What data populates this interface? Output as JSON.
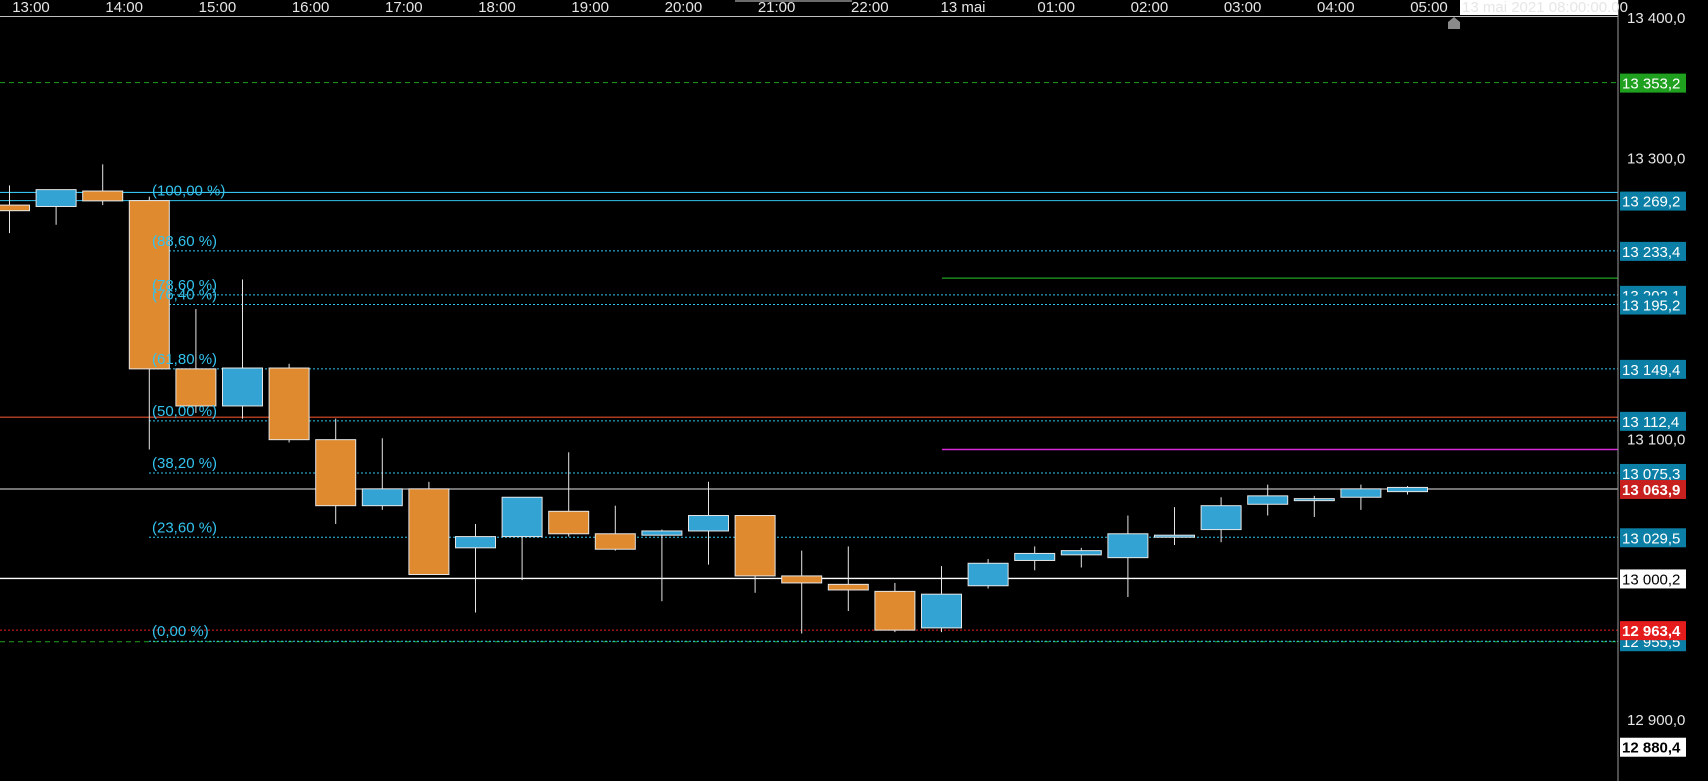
{
  "chart_data": {
    "type": "candlestick",
    "x_tick_labels": [
      "13:00",
      "14:00",
      "15:00",
      "16:00",
      "17:00",
      "18:00",
      "19:00",
      "20:00",
      "21:00",
      "22:00",
      "13 mai",
      "01:00",
      "02:00",
      "03:00",
      "04:00",
      "05:00"
    ],
    "crosshair_time": "13 mai 2021 08:00:00.00",
    "y_tick_labels": [
      "13 400,0",
      "13 300,0",
      "13 100,0",
      "12 900,0"
    ],
    "ylim": [
      12856,
      13412
    ],
    "candles": [
      {
        "o": 13266,
        "h": 13280,
        "l": 13246,
        "c": 13262
      },
      {
        "o": 13265,
        "h": 13275,
        "l": 13252,
        "c": 13277
      },
      {
        "o": 13276,
        "h": 13295,
        "l": 13266,
        "c": 13269
      },
      {
        "o": 13269.2,
        "h": 13272,
        "l": 13092,
        "c": 13149.4
      },
      {
        "o": 13149.4,
        "h": 13192,
        "l": 13118,
        "c": 13123
      },
      {
        "o": 13123,
        "h": 13213,
        "l": 13114,
        "c": 13150
      },
      {
        "o": 13150,
        "h": 13153,
        "l": 13097,
        "c": 13099
      },
      {
        "o": 13099,
        "h": 13114,
        "l": 13039,
        "c": 13052
      },
      {
        "o": 13052,
        "h": 13100,
        "l": 13049,
        "c": 13064
      },
      {
        "o": 13064,
        "h": 13069,
        "l": 13004,
        "c": 13003
      },
      {
        "o": 13022,
        "h": 13039,
        "l": 12976,
        "c": 13030
      },
      {
        "o": 13030,
        "h": 13058,
        "l": 12999,
        "c": 13058
      },
      {
        "o": 13048,
        "h": 13090,
        "l": 13030,
        "c": 13032
      },
      {
        "o": 13032,
        "h": 13052,
        "l": 13020,
        "c": 13021
      },
      {
        "o": 13031,
        "h": 13035,
        "l": 12984,
        "c": 13034
      },
      {
        "o": 13034,
        "h": 13069,
        "l": 13010,
        "c": 13045
      },
      {
        "o": 13045,
        "h": 13041,
        "l": 12990,
        "c": 13002
      },
      {
        "o": 13002,
        "h": 13020,
        "l": 12961,
        "c": 12997
      },
      {
        "o": 12996,
        "h": 13023,
        "l": 12977,
        "c": 12992
      },
      {
        "o": 12991,
        "h": 12997,
        "l": 12962,
        "c": 12963.4
      },
      {
        "o": 12965,
        "h": 13009,
        "l": 12962,
        "c": 12989
      },
      {
        "o": 12995,
        "h": 13014,
        "l": 12993,
        "c": 13011
      },
      {
        "o": 13013,
        "h": 13023,
        "l": 13006,
        "c": 13018
      },
      {
        "o": 13017,
        "h": 13022,
        "l": 13008,
        "c": 13020
      },
      {
        "o": 13015,
        "h": 13045,
        "l": 12987,
        "c": 13032
      },
      {
        "o": 13031,
        "h": 13051,
        "l": 13024,
        "c": 13031
      },
      {
        "o": 13035,
        "h": 13058,
        "l": 13026,
        "c": 13052
      },
      {
        "o": 13053,
        "h": 13067,
        "l": 13045,
        "c": 13059
      },
      {
        "o": 13057,
        "h": 13059,
        "l": 13044,
        "c": 13057
      },
      {
        "o": 13058,
        "h": 13067,
        "l": 13049,
        "c": 13064
      },
      {
        "o": 13062,
        "h": 13066,
        "l": 13060,
        "c": 13065
      }
    ],
    "fib_levels": [
      {
        "label": "(100,00 %)",
        "value": 13269.2,
        "price_label": "13 269,2"
      },
      {
        "label": "(88,60 %)",
        "value": 13233.4,
        "price_label": "13 233,4"
      },
      {
        "label": "(78,60 %)",
        "value": 13202.1,
        "price_label": "13 202,1"
      },
      {
        "label": "(76,40 %)",
        "value": 13195.2,
        "price_label": "13 195,2"
      },
      {
        "label": "(61,80 %)",
        "value": 13149.4,
        "price_label": "13 149,4"
      },
      {
        "label": "(50,00 %)",
        "value": 13112.4,
        "price_label": "13 112,4"
      },
      {
        "label": "(38,20 %)",
        "value": 13075.3,
        "price_label": "13 075,3"
      },
      {
        "label": "(23,60 %)",
        "value": 13029.5,
        "price_label": "13 029,5"
      },
      {
        "label": "(0,00 %)",
        "value": 12955.5,
        "price_label": "12 955,5"
      }
    ],
    "horizontal_lines": {
      "resistance_dashed": {
        "value": 13353.2,
        "label": "13 353,2",
        "color": "#1fa11f"
      },
      "support_dashed": {
        "value": 12955.5,
        "color": "#1fa11f"
      },
      "blue_solid": {
        "value": 13275,
        "color": "#33c3ee"
      },
      "red_solid": {
        "value": 13115,
        "color": "#e0502a"
      },
      "last_price": {
        "value": 13063.9,
        "label": "13 063,9",
        "color": "#c8201e"
      },
      "round_level": {
        "value": 13000.2,
        "label": "13 000,2"
      },
      "low_level": {
        "value": 12963.4,
        "label": "12 963,4",
        "color": "#e51c1c"
      },
      "bottom_label": {
        "value": 12880.4,
        "label": "12 880,4"
      }
    },
    "segments": [
      {
        "value": 13214,
        "color": "#1fa11f"
      },
      {
        "value": 13092,
        "color": "#d62ad6"
      }
    ],
    "colors": {
      "up": "#33a3d4",
      "down": "#e08a30",
      "axis_bg": "#000000",
      "text": "#e6e6e6",
      "fib": "#33c3ee"
    }
  }
}
